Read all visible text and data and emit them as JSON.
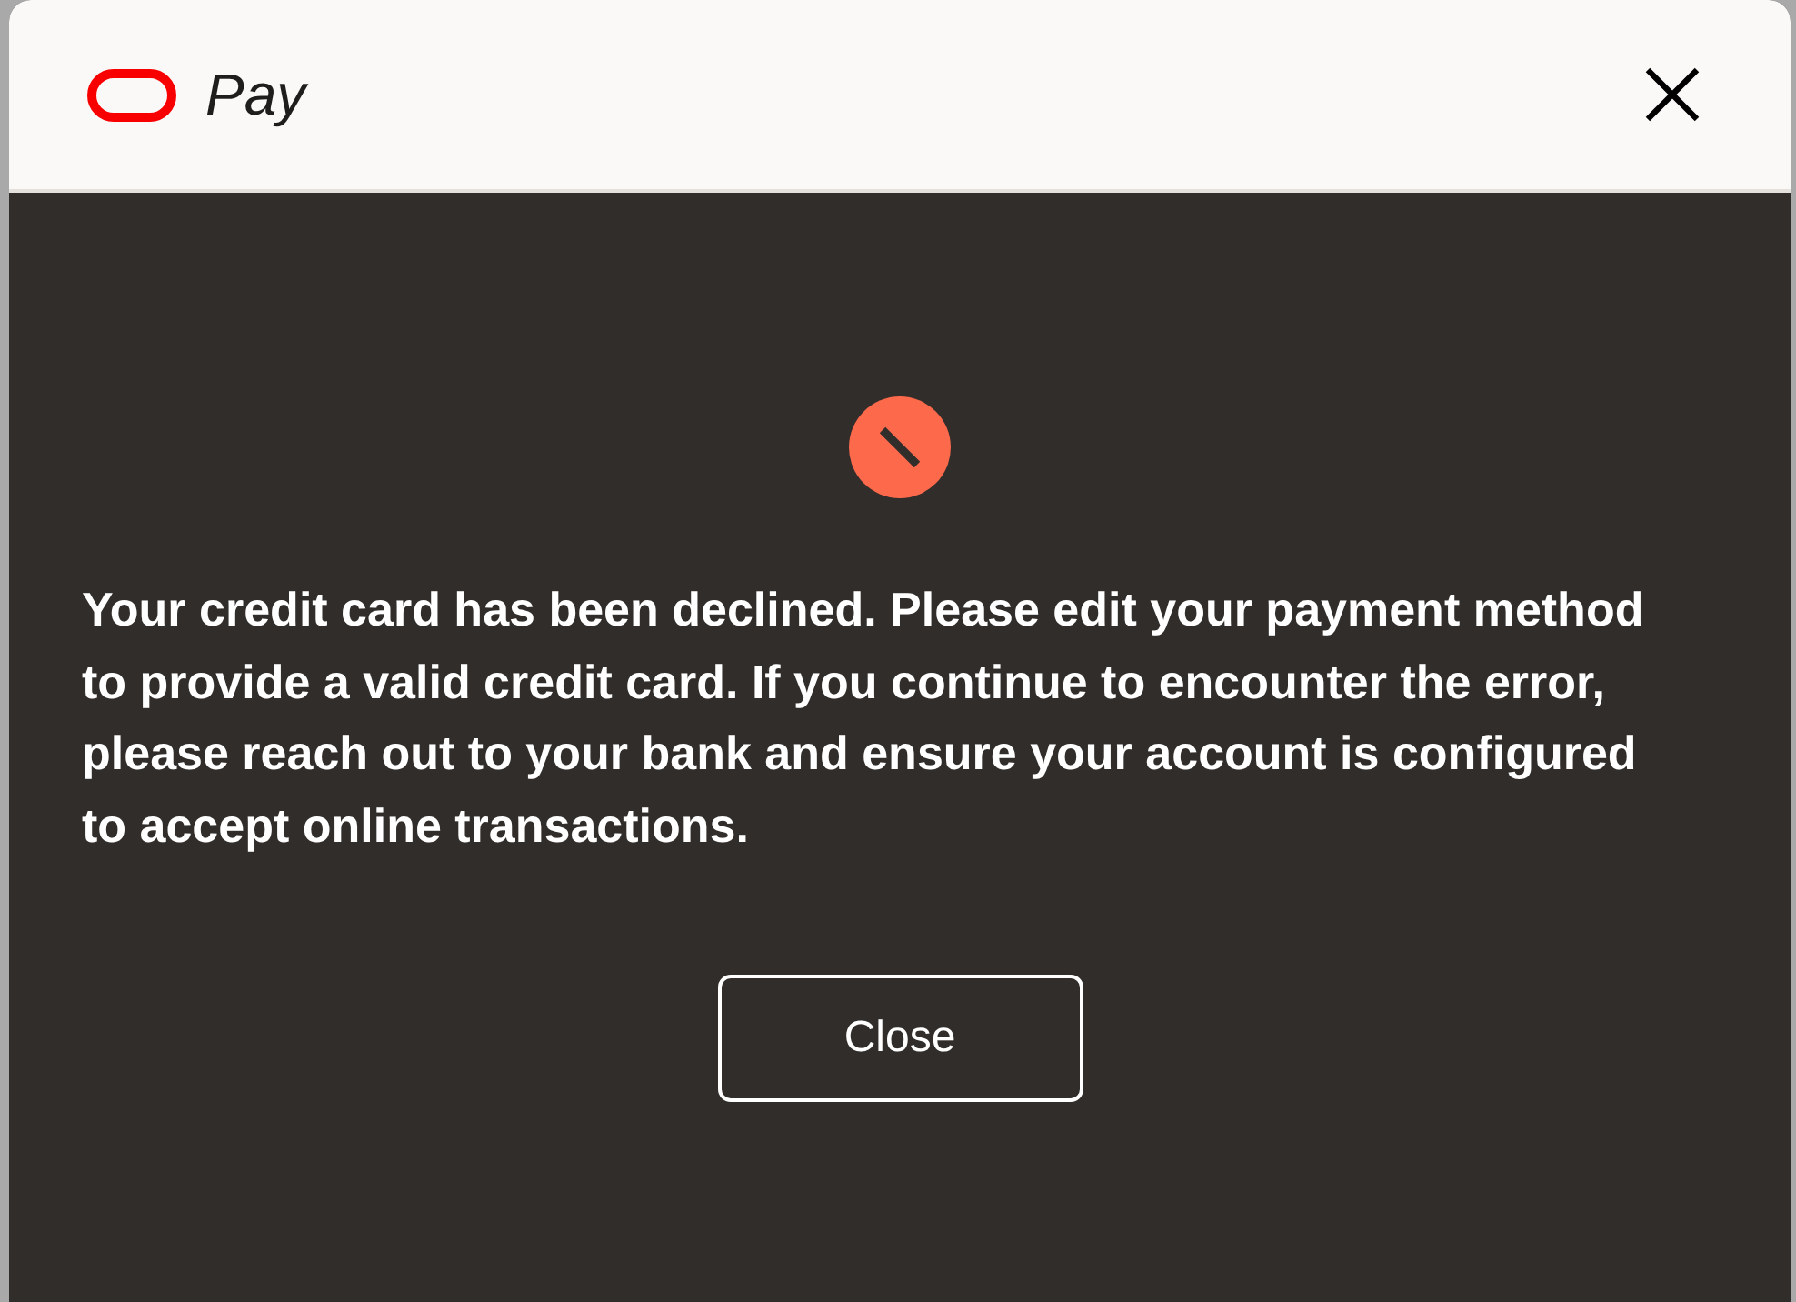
{
  "dialog": {
    "header": {
      "brand": "Pay"
    },
    "message": "Your credit card has been declined. Please edit your payment method to provide a valid credit card. If you continue to encounter the error, please reach out to your bank and ensure your account is configured to accept online transactions.",
    "buttons": [
      {
        "label": "Close"
      }
    ]
  }
}
